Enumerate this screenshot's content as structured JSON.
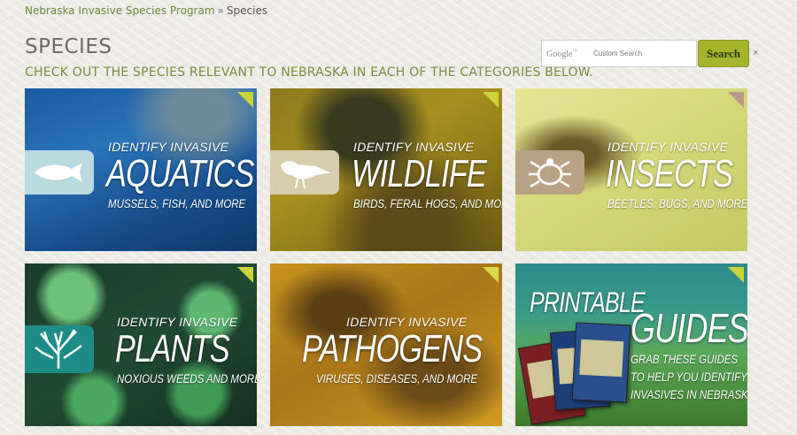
{
  "breadcrumb": {
    "home_label": "Nebraska Invasive Species Program",
    "separator": "»",
    "current_label": "Species"
  },
  "header": {
    "title": "SPECIES",
    "subtitle": "CHECK OUT THE SPECIES RELEVANT TO NEBRASKA IN EACH OF THE CATEGORIES BELOW."
  },
  "search": {
    "logo_text": "Google",
    "placeholder": "Custom Search",
    "button_label": "Search",
    "clear_label": "×"
  },
  "tiles": [
    {
      "kicker": "IDENTIFY INVASIVE",
      "title": "AQUATICS",
      "sub": "MUSSELS, FISH, AND MORE",
      "icon": "fish-icon",
      "badge_color": "#b9dbe0",
      "corner_color": "#c8d43a"
    },
    {
      "kicker": "IDENTIFY INVASIVE",
      "title": "WILDLIFE",
      "sub": "BIRDS, FERAL HOGS, AND MORE",
      "icon": "bird-icon",
      "badge_color": "#d8ccae",
      "corner_color": "#c8d43a"
    },
    {
      "kicker": "IDENTIFY INVASIVE",
      "title": "INSECTS",
      "sub": "BEETLES, BUGS, AND MORE",
      "icon": "beetle-icon",
      "badge_color": "#b8a184",
      "corner_color": "#b89a86"
    },
    {
      "kicker": "IDENTIFY INVASIVE",
      "title": "PLANTS",
      "sub": "NOXIOUS WEEDS AND MORE",
      "icon": "plant-icon",
      "badge_color": "#1e8c86",
      "corner_color": "#c8d43a"
    },
    {
      "kicker": "IDENTIFY INVASIVE",
      "title": "PATHOGENS",
      "sub": "VIRUSES, DISEASES, AND MORE",
      "icon": "",
      "badge_color": "",
      "corner_color": "#d8d84a"
    },
    {
      "kicker": "PRINTABLE",
      "title": "GUIDES",
      "sub_lines": [
        "GRAB THESE GUIDES",
        "TO HELP YOU IDENTIFY",
        "INVASIVES IN NEBRASKA"
      ],
      "icon": "guides-books-icon",
      "corner_color": "#c8d43a"
    }
  ]
}
